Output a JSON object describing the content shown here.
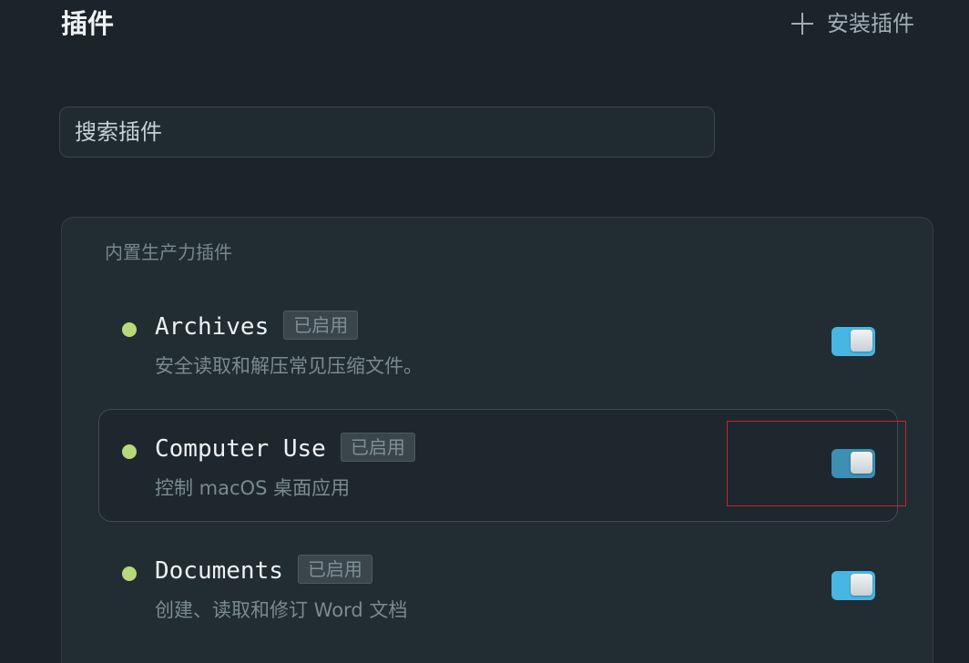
{
  "header": {
    "title": "插件",
    "install_label": "安装插件",
    "install_icon": "plus-icon"
  },
  "search": {
    "placeholder": "搜索插件",
    "value": ""
  },
  "section": {
    "label": "内置生产力插件",
    "plugins": [
      {
        "name": "Archives",
        "badge": "已启用",
        "description": "安全读取和解压常见压缩文件。",
        "enabled": true,
        "status_color": "#b7d97b"
      },
      {
        "name": "Computer Use",
        "badge": "已启用",
        "description": "控制 macOS 桌面应用",
        "enabled": true,
        "status_color": "#b7d97b"
      },
      {
        "name": "Documents",
        "badge": "已启用",
        "description": "创建、读取和修订 Word 文档",
        "enabled": true,
        "status_color": "#b7d97b"
      }
    ]
  },
  "colors": {
    "background": "#1b242b",
    "toggle_on": "#48b6e2",
    "highlight": "#c8262e"
  }
}
